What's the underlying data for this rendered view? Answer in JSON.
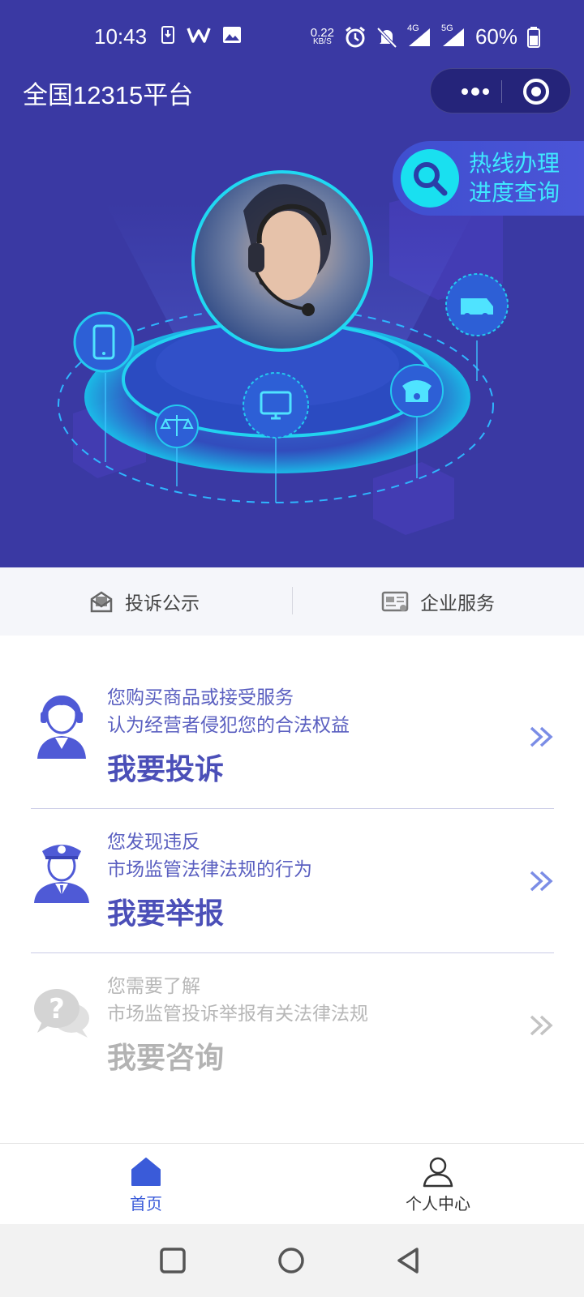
{
  "status_bar": {
    "time": "10:43",
    "net_speed_value": "0.22",
    "net_speed_unit": "KB/S",
    "net_4g": "4G",
    "net_5g": "5G",
    "battery": "60%"
  },
  "header": {
    "title": "全国12315平台"
  },
  "hotline": {
    "line1": "热线办理",
    "line2": "进度查询"
  },
  "tabs": [
    {
      "label": "投诉公示",
      "icon": "envelope-icon"
    },
    {
      "label": "企业服务",
      "icon": "business-license-icon"
    }
  ],
  "cards": [
    {
      "desc1": "您购买商品或接受服务",
      "desc2": "认为经营者侵犯您的合法权益",
      "action": "我要投诉",
      "icon": "customer-service-agent-icon"
    },
    {
      "desc1": "您发现违反",
      "desc2": "市场监管法律法规的行为",
      "action": "我要举报",
      "icon": "inspector-officer-icon"
    },
    {
      "desc1": "您需要了解",
      "desc2": "市场监管投诉举报有关法律法规",
      "action": "我要咨询",
      "icon": "question-bubble-icon"
    }
  ],
  "bottom_nav": [
    {
      "label": "首页",
      "icon": "home-icon",
      "active": true
    },
    {
      "label": "个人中心",
      "icon": "user-icon",
      "active": false
    }
  ],
  "colors": {
    "hero_bg": "#3a39a3",
    "accent_cyan": "#19e0f0",
    "primary_text": "#4b4fb8",
    "nav_active": "#3a5bd9"
  }
}
